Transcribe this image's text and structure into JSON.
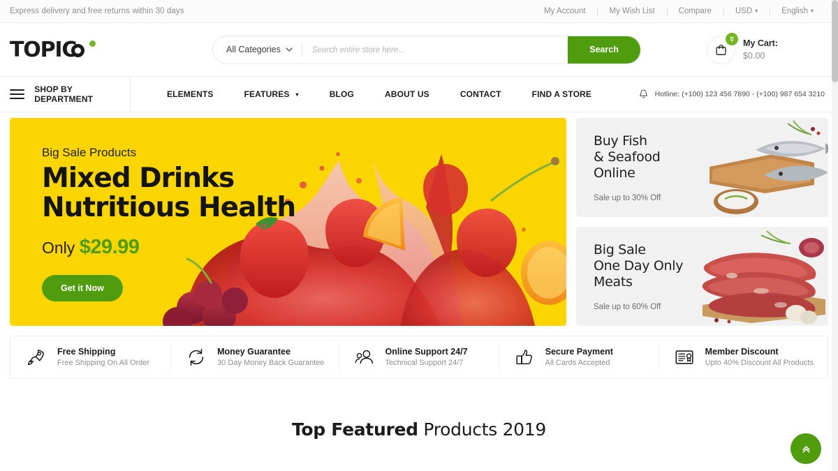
{
  "topbar": {
    "announcement": "Express delivery and free returns within 30 days",
    "links": [
      {
        "label": "My Account",
        "caret": false
      },
      {
        "label": "My Wish List",
        "caret": false
      },
      {
        "label": "Compare",
        "caret": false
      },
      {
        "label": "USD",
        "caret": true
      },
      {
        "label": "English",
        "caret": true
      }
    ],
    "caret_glyph": "⌄"
  },
  "header": {
    "logo_text": "TOPIC",
    "search": {
      "category_label": "All Categories",
      "placeholder": "Search entire store here...",
      "value": "",
      "button_label": "Search"
    },
    "cart": {
      "count": "0",
      "label": "My Cart:",
      "amount": "$0.00"
    }
  },
  "nav": {
    "department_label": "SHOP BY DEPARTMENT",
    "items": [
      {
        "label": "ELEMENTS",
        "caret": false
      },
      {
        "label": "FEATURES",
        "caret": true
      },
      {
        "label": "BLOG",
        "caret": false
      },
      {
        "label": "ABOUT US",
        "caret": false
      },
      {
        "label": "CONTACT",
        "caret": false
      },
      {
        "label": "FIND A STORE",
        "caret": false
      }
    ],
    "hotline": "Hotline: (+100) 123 456 7890 - (+100) 987 654 3210"
  },
  "hero": {
    "kicker": "Big Sale Products",
    "title_line1": "Mixed Drinks",
    "title_line2": "Nutritious Health",
    "price_prefix": "Only",
    "price": "$29.99",
    "cta_label": "Get it Now",
    "background_color": "#fbd500"
  },
  "promos": [
    {
      "title_line1": "Buy Fish",
      "title_line2": "& Seafood",
      "title_line3": "Online",
      "subtitle": "Sale up to 30% Off"
    },
    {
      "title_line1": "Big Sale",
      "title_line2": "One Day Only",
      "title_line3": "Meats",
      "subtitle": "Sale up to 60% Off"
    }
  ],
  "services": [
    {
      "icon": "rocket-icon",
      "title": "Free Shipping",
      "subtitle": "Free Shipping On All Order"
    },
    {
      "icon": "refresh-arrows-icon",
      "title": "Money Guarantee",
      "subtitle": "30 Day Money Back Guarantee"
    },
    {
      "icon": "people-icon",
      "title": "Online Support 24/7",
      "subtitle": "Technical Support 24/7"
    },
    {
      "icon": "thumbs-up-icon",
      "title": "Secure Payment",
      "subtitle": "All Cards Accepted"
    },
    {
      "icon": "certificate-icon",
      "title": "Member Discount",
      "subtitle": "Upto 40% Discount All Products"
    }
  ],
  "section": {
    "heading_bold": "Top Featured",
    "heading_light": " Products 2019"
  },
  "colors": {
    "accent_green": "#4f9d0e",
    "badge_green": "#72b626",
    "hero_yellow": "#fbd500",
    "text_dark": "#1b1b1b",
    "text_muted": "#8e8e8e"
  }
}
